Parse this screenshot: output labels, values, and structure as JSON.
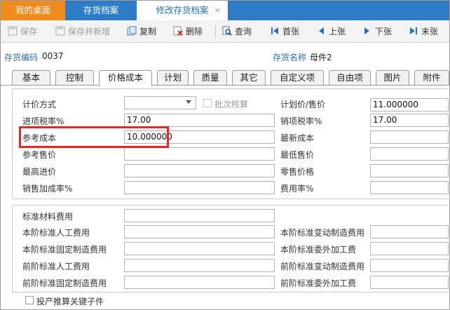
{
  "tabs": {
    "home": "我的桌面",
    "archive": "存货档案",
    "edit": "修改存货档案",
    "close_glyph": "×"
  },
  "toolbar": {
    "save": "保存",
    "save_new": "保存并新增",
    "copy": "复制",
    "delete": "删除",
    "query": "查询",
    "first": "首张",
    "prev": "上张",
    "next": "下张",
    "last": "末张"
  },
  "header": {
    "code_label": "存货编码",
    "code_value": "0037",
    "name_label": "存货名称",
    "name_value": "母件2"
  },
  "page_tabs": [
    "基本",
    "控制",
    "价格成本",
    "计划",
    "质量",
    "其它",
    "自定义项",
    "自由项",
    "图片",
    "附件"
  ],
  "active_tab": "价格成本",
  "price": {
    "pricing_method_label": "计价方式",
    "pricing_method_value": "",
    "batch_cost_label": "批次核算",
    "plan_price_label": "计划价/售价",
    "plan_price_value": "11.000000",
    "input_tax_label": "进项税率%",
    "input_tax_value": "17.00",
    "output_tax_label": "销项税率%",
    "output_tax_value": "17.00",
    "ref_cost_label": "参考成本",
    "ref_cost_value": "10.000000",
    "latest_cost_label": "最新成本",
    "ref_price_label": "参考售价",
    "min_price_label": "最低售价",
    "max_purchase_label": "最高进价",
    "retail_price_label": "零售价格",
    "sales_markup_label": "销售加成率%",
    "expense_rate_label": "费用率%"
  },
  "standard": {
    "material_label": "标准材料费用",
    "labor_label": "本阶标准人工费用",
    "var_mfg_label": "本阶标准变动制造费用",
    "fixed_mfg_label": "本阶标准固定制造费用",
    "outsource_label": "本阶标准委外加工费",
    "prev_labor_label": "前阶标准人工费用",
    "prev_var_mfg_label": "前阶标准变动制造费用",
    "prev_fixed_mfg_label": "前阶标准固定制造费用",
    "prev_outsource_label": "前阶标准委外加工费"
  },
  "footer": {
    "key_component_label": "投产推算关键子件"
  },
  "colors": {
    "tab_bar": "#2c7dc6",
    "home_tab": "#f08c1e",
    "label_blue": "#2c6fb0",
    "highlight": "#e8262a"
  }
}
